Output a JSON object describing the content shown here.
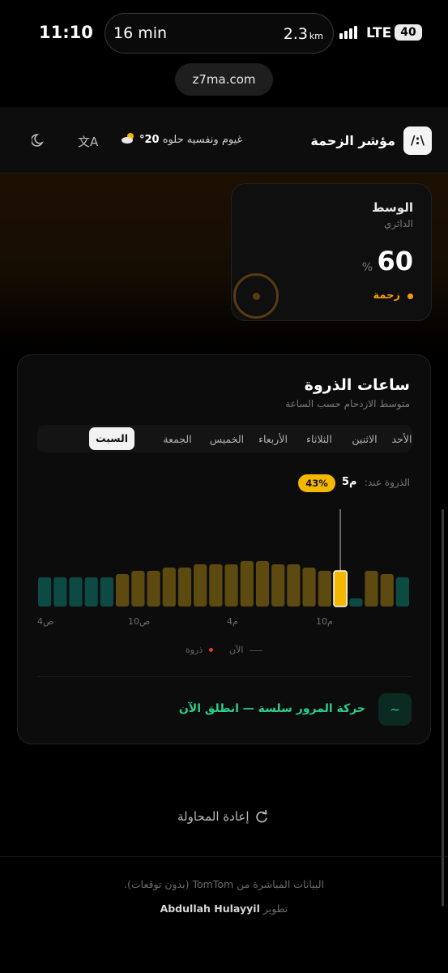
{
  "status_bar": {
    "time": "11:10",
    "island_left": "16 min",
    "island_right": "2.3",
    "island_unit": "km",
    "network": "LTE",
    "battery": "40"
  },
  "browser": {
    "url": "z7ma.com"
  },
  "header": {
    "logo": "/:\\",
    "title": "مؤشر الزحمة",
    "weather_temp": "20°",
    "weather_desc": "غيوم ونفسيه حلوه",
    "icons": [
      "translate-icon",
      "moon-icon",
      "cloud-sun-icon"
    ]
  },
  "region_card": {
    "title": "الوسط",
    "subtitle": "الدائري",
    "value": "60",
    "unit": "%",
    "status": "زحمة",
    "status_color": "#f39c12"
  },
  "peak_card": {
    "title": "ساعات الذروة",
    "subtitle": "متوسط الازدحام حسب الساعة",
    "tabs": [
      "الأحد",
      "الاثنين",
      "الثلاثاء",
      "الأربعاء",
      "الخميس",
      "الجمعة",
      "السبت"
    ],
    "active_tab": "السبت",
    "peak_label": "الذروة عند:",
    "peak_hour": "5م",
    "peak_badge": "43%",
    "x_ticks": [
      "4ص",
      "10ص",
      "4م",
      "10م"
    ],
    "legend_now": "الآن",
    "legend_peak": "ذروة",
    "status_text": "حركة المرور سلسة — انطلق الآن",
    "status_icon": "~"
  },
  "chart_data": {
    "type": "bar",
    "colors": {
      "low": "#0d4a44",
      "medium": "#5c4a10",
      "current": "#f5b800"
    },
    "bars": [
      {
        "level": "low",
        "value": 18
      },
      {
        "level": "low",
        "value": 18
      },
      {
        "level": "low",
        "value": 18
      },
      {
        "level": "low",
        "value": 18
      },
      {
        "level": "low",
        "value": 18
      },
      {
        "level": "medium",
        "value": 20
      },
      {
        "level": "medium",
        "value": 22
      },
      {
        "level": "medium",
        "value": 22
      },
      {
        "level": "medium",
        "value": 24
      },
      {
        "level": "medium",
        "value": 24
      },
      {
        "level": "medium",
        "value": 26
      },
      {
        "level": "medium",
        "value": 26
      },
      {
        "level": "medium",
        "value": 26
      },
      {
        "level": "medium",
        "value": 28
      },
      {
        "level": "medium",
        "value": 28
      },
      {
        "level": "medium",
        "value": 26
      },
      {
        "level": "medium",
        "value": 26
      },
      {
        "level": "medium",
        "value": 24
      },
      {
        "level": "medium",
        "value": 22
      },
      {
        "level": "current",
        "value": 22
      },
      {
        "level": "low",
        "value": 5
      },
      {
        "level": "medium",
        "value": 22
      },
      {
        "level": "medium",
        "value": 20
      },
      {
        "level": "low",
        "value": 18
      }
    ],
    "current_index": 19,
    "peak_marker_index": 13
  },
  "retry": {
    "label": "إعادة المحاولة"
  },
  "footer": {
    "line1": "البيانات المباشرة من TomTom (بدون توقعات).",
    "dev_label": "تطوير",
    "dev_name": "Abdullah Hulayyil"
  }
}
